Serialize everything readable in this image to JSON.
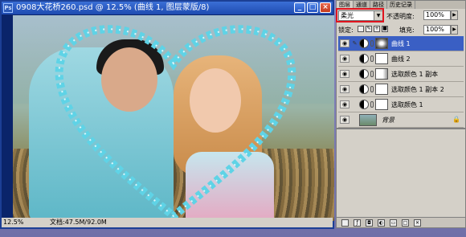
{
  "document": {
    "title": "0908大花桥260.psd @ 12.5% (曲线 1, 图层蒙版/8)",
    "zoom": "12.5%",
    "doc_info": "文档:47.5M/92.0M"
  },
  "window_controls": {
    "minimize": "_",
    "maximize": "□",
    "close": "×"
  },
  "layers_panel": {
    "tabs": [
      "图层",
      "通道",
      "路径",
      "历史记录"
    ],
    "blend_mode": "柔光",
    "opacity_label": "不透明度:",
    "opacity_value": "100%",
    "lock_label": "锁定:",
    "fill_label": "填充:",
    "fill_value": "100%",
    "layers": [
      {
        "name": "曲线 1",
        "selected": true
      },
      {
        "name": "曲线 2",
        "selected": false
      },
      {
        "name": "选取颜色 1 副本",
        "selected": false
      },
      {
        "name": "选取颜色 1 副本 2",
        "selected": false
      },
      {
        "name": "选取颜色 1",
        "selected": false
      },
      {
        "name": "背景",
        "selected": false
      }
    ]
  },
  "colors": {
    "highlight": "#e0141e",
    "selected_layer": "#3a5fc4",
    "heart_frame": "#5fd3e6"
  }
}
